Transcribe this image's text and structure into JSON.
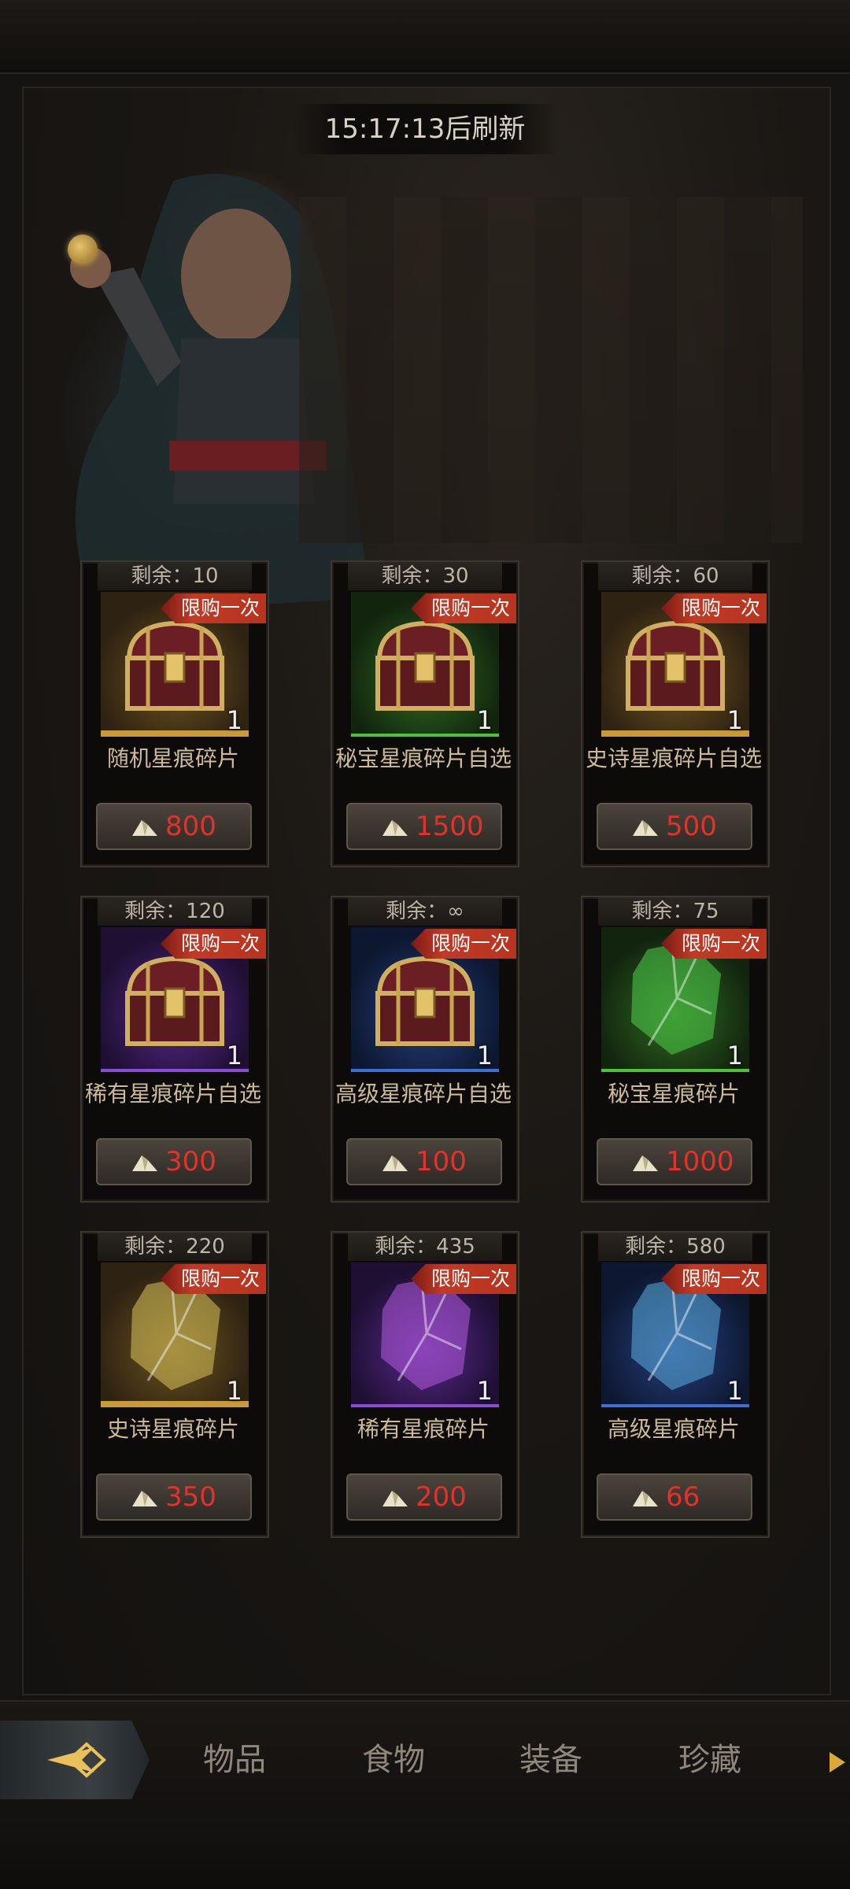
{
  "timer": "15:17:13后刷新",
  "cards": [
    {
      "remain": "剩余：10",
      "badge": "限购一次",
      "qty": "1",
      "name": "随机星痕碎片",
      "price": "800",
      "kind": "chest",
      "rarity": "gold"
    },
    {
      "remain": "剩余：30",
      "badge": "限购一次",
      "qty": "1",
      "name": "秘宝星痕碎片自选",
      "price": "1500",
      "kind": "chest",
      "rarity": "green"
    },
    {
      "remain": "剩余：60",
      "badge": "限购一次",
      "qty": "1",
      "name": "史诗星痕碎片自选",
      "price": "500",
      "kind": "chest",
      "rarity": "gold"
    },
    {
      "remain": "剩余：120",
      "badge": "限购一次",
      "qty": "1",
      "name": "稀有星痕碎片自选",
      "price": "300",
      "kind": "chest",
      "rarity": "purple"
    },
    {
      "remain": "剩余：∞",
      "badge": "限购一次",
      "qty": "1",
      "name": "高级星痕碎片自选",
      "price": "100",
      "kind": "chest",
      "rarity": "blue"
    },
    {
      "remain": "剩余：75",
      "badge": "限购一次",
      "qty": "1",
      "name": "秘宝星痕碎片",
      "price": "1000",
      "kind": "shard",
      "rarity": "green"
    },
    {
      "remain": "剩余：220",
      "badge": "限购一次",
      "qty": "1",
      "name": "史诗星痕碎片",
      "price": "350",
      "kind": "shard",
      "rarity": "gold"
    },
    {
      "remain": "剩余：435",
      "badge": "限购一次",
      "qty": "1",
      "name": "稀有星痕碎片",
      "price": "200",
      "kind": "shard",
      "rarity": "purple"
    },
    {
      "remain": "剩余：580",
      "badge": "限购一次",
      "qty": "1",
      "name": "高级星痕碎片",
      "price": "66",
      "kind": "shard",
      "rarity": "blue"
    }
  ],
  "tabs": [
    "物品",
    "食物",
    "装备",
    "珍藏"
  ],
  "colors": {
    "price": "#e3322a",
    "badge": "#c03a26",
    "gold": "#c99a38",
    "green": "#4cc23a",
    "purple": "#8b4bd6",
    "blue": "#3c70d6"
  },
  "icons": {
    "back": "back-arrow-icon",
    "next": "next-arrow-icon",
    "currency": "crystal-currency-icon"
  }
}
